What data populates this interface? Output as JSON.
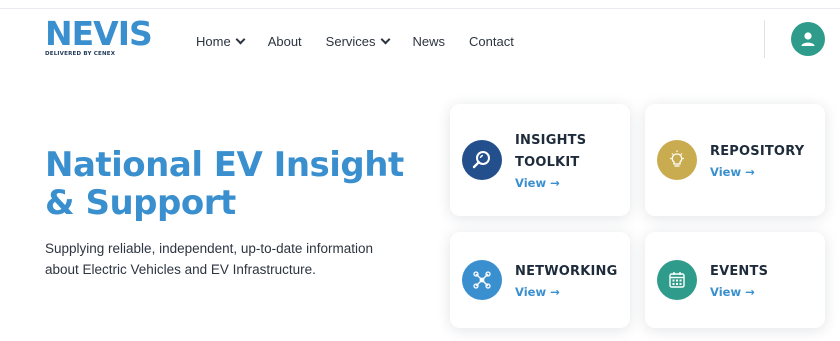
{
  "brand": {
    "name": "NEVIS",
    "tagline": "DELIVERED BY CENEX"
  },
  "nav": {
    "items": [
      {
        "label": "Home",
        "dropdown": true
      },
      {
        "label": "About",
        "dropdown": false
      },
      {
        "label": "Services",
        "dropdown": true
      },
      {
        "label": "News",
        "dropdown": false
      },
      {
        "label": "Contact",
        "dropdown": false
      }
    ]
  },
  "hero": {
    "title_line1": "National EV Insight",
    "title_line2": "& Support",
    "desc_line1": "Supplying reliable, independent, up-to-date information",
    "desc_line2": "about Electric Vehicles and EV Infrastructure."
  },
  "cards": [
    {
      "title_line1": "INSIGHTS",
      "title_line2": "TOOLKIT",
      "link": "View →",
      "icon": "magnifier-icon",
      "color": "#234f8c"
    },
    {
      "title_line1": "REPOSITORY",
      "title_line2": "",
      "link": "View →",
      "icon": "lightbulb-icon",
      "color": "#c9ac4f"
    },
    {
      "title_line1": "NETWORKING",
      "title_line2": "",
      "link": "View →",
      "icon": "network-icon",
      "color": "#3a8fcf"
    },
    {
      "title_line1": "EVENTS",
      "title_line2": "",
      "link": "View →",
      "icon": "calendar-icon",
      "color": "#2f9b8a"
    }
  ],
  "colors": {
    "brand_blue": "#3a8fcf",
    "navy": "#234f8c",
    "gold": "#c9ac4f",
    "teal": "#2f9b8a"
  }
}
